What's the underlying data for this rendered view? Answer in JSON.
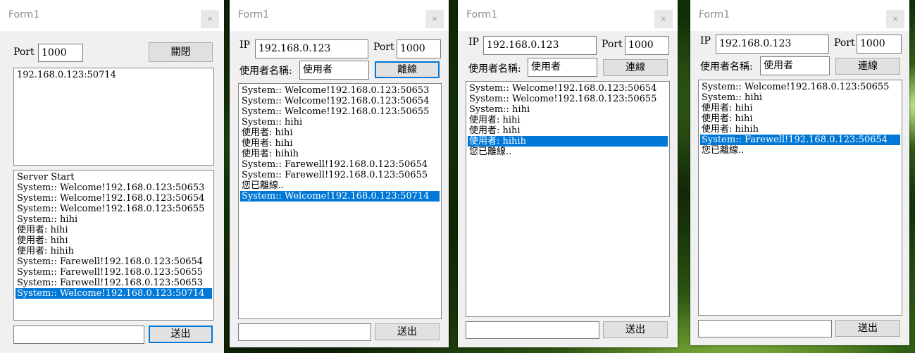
{
  "server": {
    "title": "Form1",
    "close_glyph": "×",
    "port_label": "Port",
    "port_value": "1000",
    "close_button": "關閉",
    "clients": [
      "192.168.0.123:50714"
    ],
    "log": [
      "Server Start",
      "System:: Welcome!192.168.0.123:50653",
      "System:: Welcome!192.168.0.123:50654",
      "System:: Welcome!192.168.0.123:50655",
      "System:: hihi",
      "使用者: hihi",
      "使用者: hihi",
      "使用者: hihih",
      "System:: Farewell!192.168.0.123:50654",
      "System:: Farewell!192.168.0.123:50655",
      "System:: Farewell!192.168.0.123:50653",
      "System:: Welcome!192.168.0.123:50714"
    ],
    "selected_index": 11,
    "message_value": "",
    "send_button": "送出"
  },
  "client1": {
    "title": "Form1",
    "close_glyph": "×",
    "ip_label": "IP",
    "ip_value": "192.168.0.123",
    "port_label": "Port",
    "port_value": "1000",
    "username_label": "使用者名稱:",
    "username_value": "使用者",
    "connect_button": "離線",
    "log": [
      "System:: Welcome!192.168.0.123:50653",
      "System:: Welcome!192.168.0.123:50654",
      "System:: Welcome!192.168.0.123:50655",
      "System:: hihi",
      "使用者: hihi",
      "使用者: hihi",
      "使用者: hihih",
      "System:: Farewell!192.168.0.123:50654",
      "System:: Farewell!192.168.0.123:50655",
      "您已離線..",
      "System:: Welcome!192.168.0.123:50714"
    ],
    "selected_index": 10,
    "message_value": "",
    "send_button": "送出"
  },
  "client2": {
    "title": "Form1",
    "close_glyph": "×",
    "ip_label": "IP",
    "ip_value": "192.168.0.123",
    "port_label": "Port",
    "port_value": "1000",
    "username_label": "使用者名稱:",
    "username_value": "使用者",
    "connect_button": "連線",
    "log": [
      "System:: Welcome!192.168.0.123:50654",
      "System:: Welcome!192.168.0.123:50655",
      "System:: hihi",
      "使用者: hihi",
      "使用者: hihi",
      "使用者: hihih",
      "您已離線.."
    ],
    "selected_index": 5,
    "message_value": "",
    "send_button": "送出"
  },
  "client3": {
    "title": "Form1",
    "close_glyph": "×",
    "ip_label": "IP",
    "ip_value": "192.168.0.123",
    "port_label": "Port",
    "port_value": "1000",
    "username_label": "使用者名稱:",
    "username_value": "使用者",
    "connect_button": "連線",
    "log": [
      "System:: Welcome!192.168.0.123:50655",
      "System:: hihi",
      "使用者: hihi",
      "使用者: hihi",
      "使用者: hihih",
      "System:: Farewell!192.168.0.123:50654",
      "您已離線.."
    ],
    "selected_index": 5,
    "message_value": "",
    "send_button": "送出"
  }
}
